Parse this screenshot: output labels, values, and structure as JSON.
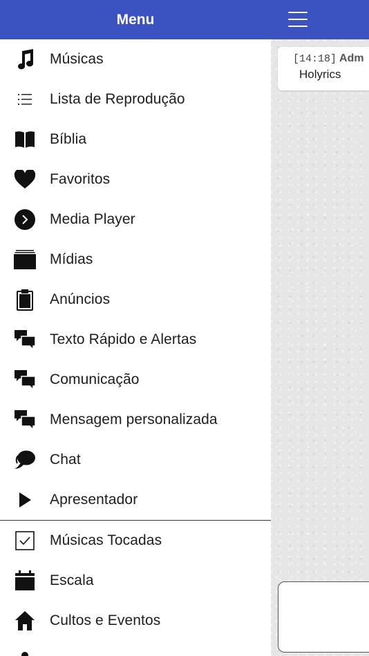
{
  "drawer": {
    "title": "Menu",
    "items": [
      {
        "label": "Músicas",
        "icon": "music-note-icon"
      },
      {
        "label": "Lista de Reprodução",
        "icon": "list-icon"
      },
      {
        "label": "Bíblia",
        "icon": "book-icon"
      },
      {
        "label": "Favoritos",
        "icon": "heart-icon"
      },
      {
        "label": "Media Player",
        "icon": "play-circle-icon"
      },
      {
        "label": "Mídias",
        "icon": "media-stack-icon"
      },
      {
        "label": "Anúncios",
        "icon": "clipboard-icon"
      },
      {
        "label": "Texto Rápido e Alertas",
        "icon": "chat-bubbles-icon"
      },
      {
        "label": "Comunicação",
        "icon": "chat-bubbles-icon"
      },
      {
        "label": "Mensagem personalizada",
        "icon": "chat-bubbles-icon"
      },
      {
        "label": "Chat",
        "icon": "chat-bubble-icon"
      },
      {
        "label": "Apresentador",
        "icon": "play-triangle-icon"
      }
    ],
    "items_secondary": [
      {
        "label": "Músicas Tocadas",
        "icon": "checkbox-icon"
      },
      {
        "label": "Escala",
        "icon": "calendar-icon"
      },
      {
        "label": "Cultos e Eventos",
        "icon": "home-icon"
      }
    ]
  },
  "chat": {
    "time": "[14:18]",
    "author": "Adm",
    "message": "Holyrics"
  },
  "colors": {
    "header": "#3d52c1",
    "header_text": "#ffffff",
    "icon": "#111111",
    "label": "#1d1d1d"
  }
}
